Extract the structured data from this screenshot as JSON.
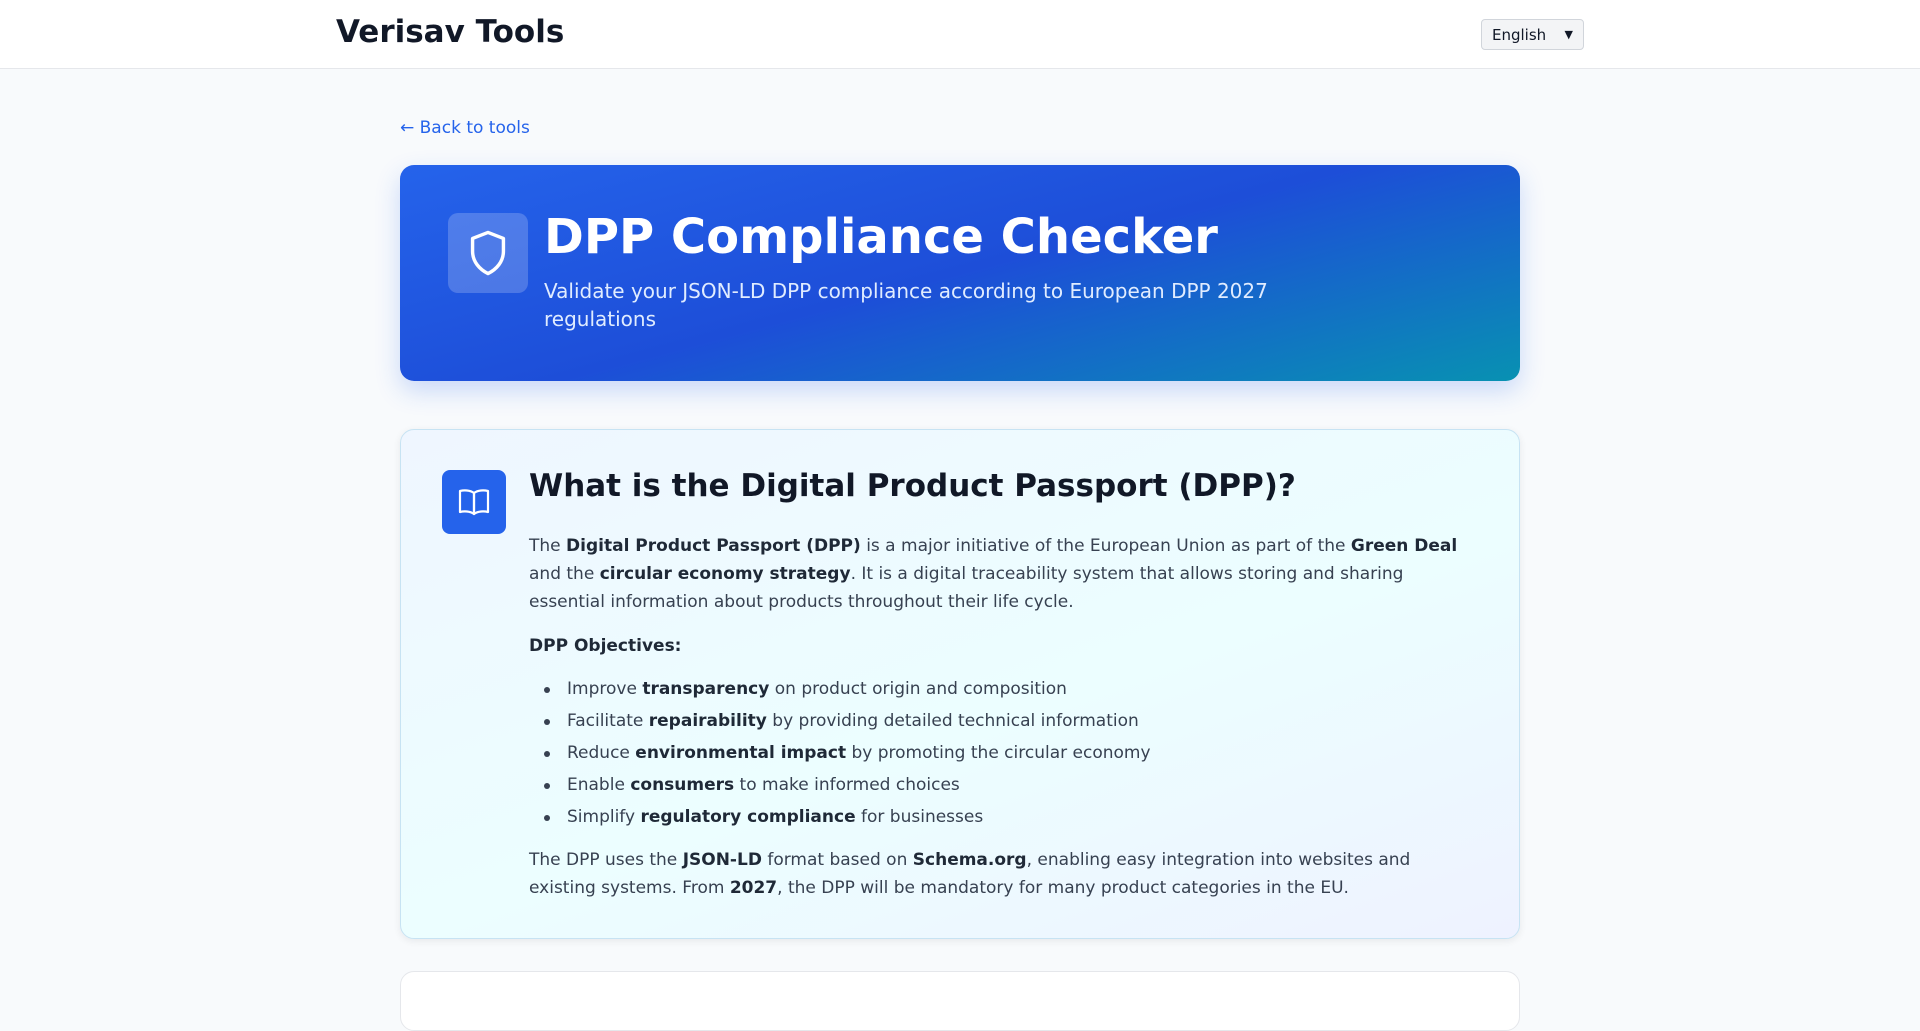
{
  "header": {
    "brand": "Verisav Tools",
    "language": {
      "selected": "English"
    }
  },
  "nav": {
    "back_label": "← Back to tools"
  },
  "hero": {
    "title": "DPP Compliance Checker",
    "subtitle": "Validate your JSON-LD DPP compliance according to European DPP 2027 regulations",
    "icon": "shield-icon"
  },
  "info": {
    "icon": "book-open-icon",
    "title": "What is the Digital Product Passport (DPP)?",
    "intro": {
      "t1": "The ",
      "b1": "Digital Product Passport (DPP)",
      "t2": " is a major initiative of the European Union as part of the ",
      "b2": "Green Deal",
      "t3": " and the ",
      "b3": "circular economy strategy",
      "t4": ". It is a digital traceability system that allows storing and sharing essential information about products throughout their life cycle."
    },
    "objectives_heading": "DPP Objectives:",
    "objectives": [
      {
        "pre": "Improve ",
        "bold": "transparency",
        "post": " on product origin and composition"
      },
      {
        "pre": "Facilitate ",
        "bold": "repairability",
        "post": " by providing detailed technical information"
      },
      {
        "pre": "Reduce ",
        "bold": "environmental impact",
        "post": " by promoting the circular economy"
      },
      {
        "pre": "Enable ",
        "bold": "consumers",
        "post": " to make informed choices"
      },
      {
        "pre": "Simplify ",
        "bold": "regulatory compliance",
        "post": " for businesses"
      }
    ],
    "closing": {
      "t1": "The DPP uses the ",
      "b1": "JSON-LD",
      "t2": " format based on ",
      "b2": "Schema.org",
      "t3": ", enabling easy integration into websites and existing systems. From ",
      "b3": "2027",
      "t4": ", the DPP will be mandatory for many product categories in the EU."
    }
  },
  "colors": {
    "accent": "#2563eb",
    "hero_gradient_start": "#2563eb",
    "hero_gradient_end": "#0891b2",
    "page_background": "#f8fafc"
  }
}
